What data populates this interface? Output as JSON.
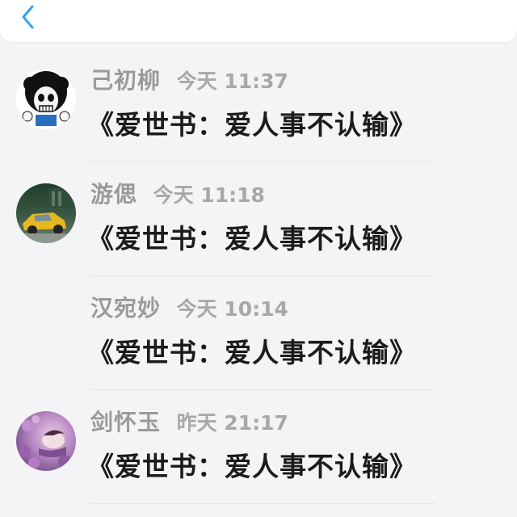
{
  "header": {
    "back_icon": "chevron-left-icon",
    "accent_color": "#3aa0f0"
  },
  "comments": [
    {
      "name": "己初柳",
      "time": "今天 11:37",
      "message": "《爱世书：爱人事不认输》",
      "avatar_icon": "skull-afro-avatar"
    },
    {
      "name": "游偲",
      "time": "今天 11:18",
      "message": "《爱世书：爱人事不认输》",
      "avatar_icon": "yellow-car-avatar"
    },
    {
      "name": "汉宛妙",
      "time": "今天 10:14",
      "message": "《爱世书：爱人事不认输》",
      "avatar_icon": ""
    },
    {
      "name": "剑怀玉",
      "time": "昨天 21:17",
      "message": "《爱世书：爱人事不认输》",
      "avatar_icon": "purple-flower-avatar"
    }
  ]
}
